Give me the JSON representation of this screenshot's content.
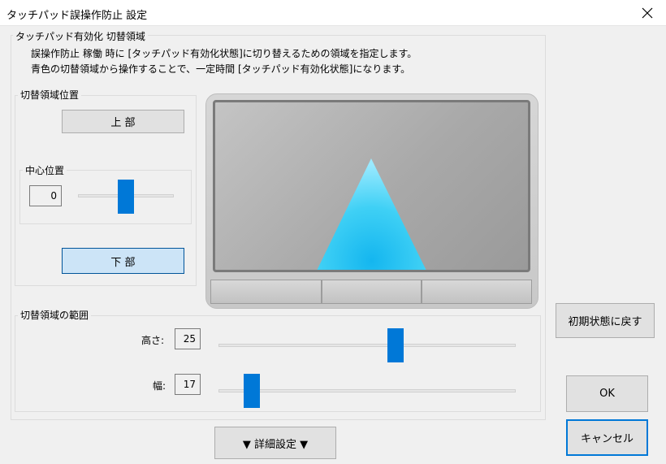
{
  "window": {
    "title": "タッチパッド誤操作防止 設定",
    "close_icon": "close-icon"
  },
  "main_group": {
    "label": "タッチパッド有効化 切替領域",
    "description_line1": "誤操作防止 稼働 時に [タッチパッド有効化状態]に切り替えるための領域を指定します。",
    "description_line2": "青色の切替領域から操作することで、一定時間 [タッチパッド有効化状態]になります。"
  },
  "position_group": {
    "label": "切替領域位置",
    "top_button": "上 部",
    "bottom_button": "下 部",
    "selected": "下 部",
    "center": {
      "label": "中心位置",
      "value": "0",
      "slider_fraction": 0.5
    }
  },
  "range_group": {
    "label": "切替領域の範囲",
    "height": {
      "label": "高さ:",
      "value": "25",
      "slider_fraction": 0.6
    },
    "width": {
      "label": "幅:",
      "value": "17",
      "slider_fraction": 0.09
    }
  },
  "preview": {
    "region_color": "#3fd0f5",
    "accent_color": "#0078d7"
  },
  "buttons": {
    "reset": "初期状態に戻す",
    "ok": "OK",
    "cancel": "キャンセル",
    "advanced": "▼ 詳細設定 ▼"
  }
}
